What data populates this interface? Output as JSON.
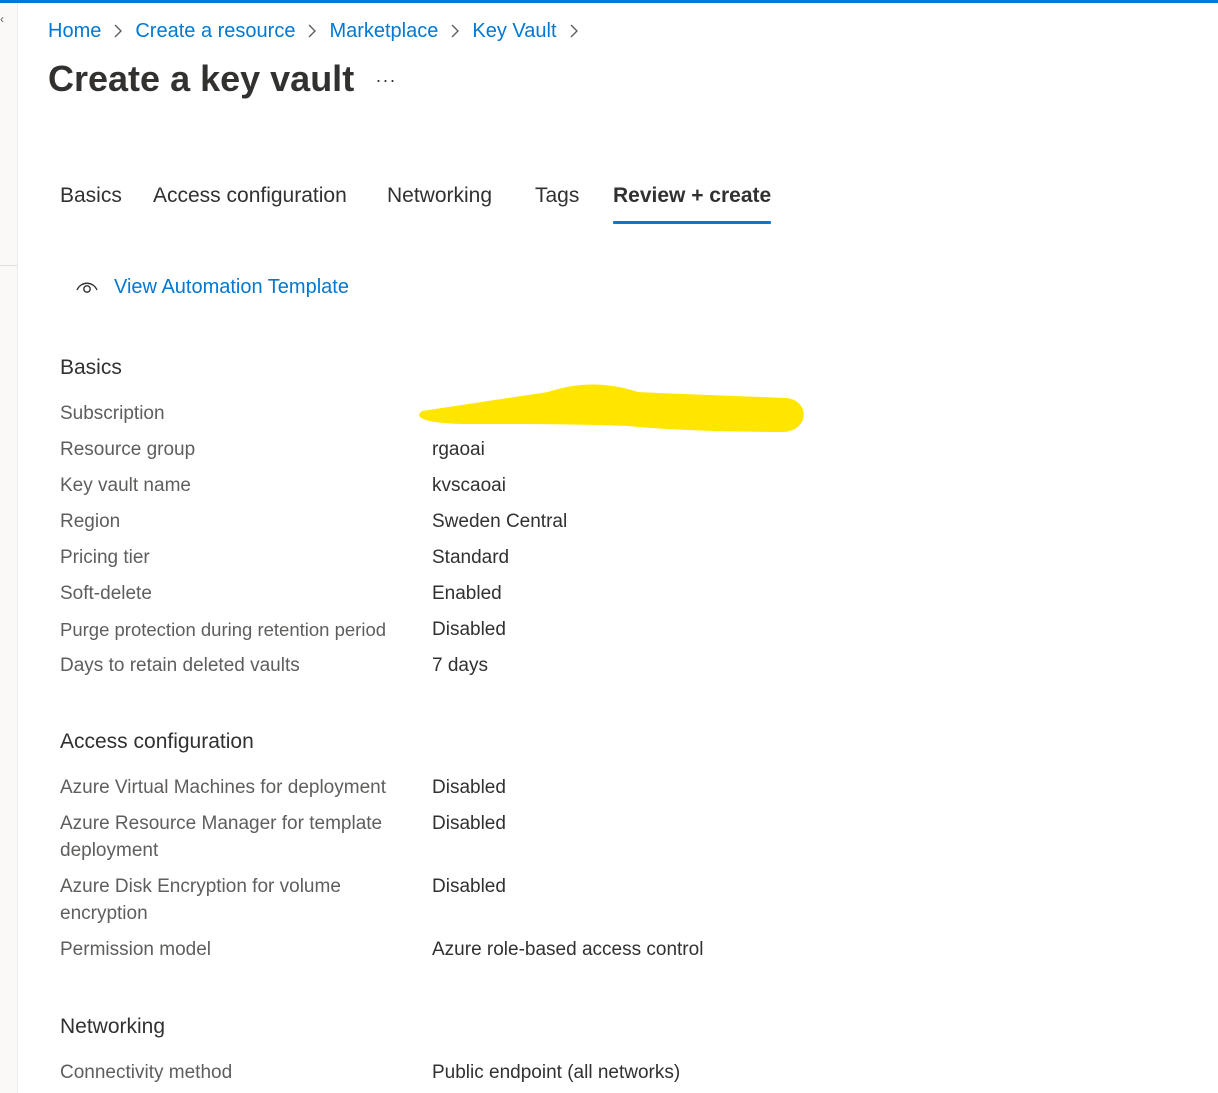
{
  "breadcrumb": {
    "items": [
      "Home",
      "Create a resource",
      "Marketplace",
      "Key Vault"
    ]
  },
  "page": {
    "title": "Create a key vault",
    "more_label": "···"
  },
  "tabs": [
    {
      "label": "Basics",
      "active": false
    },
    {
      "label": "Access configuration",
      "active": false
    },
    {
      "label": "Networking",
      "active": false
    },
    {
      "label": "Tags",
      "active": false
    },
    {
      "label": "Review + create",
      "active": true
    }
  ],
  "template_link": {
    "label": "View Automation Template",
    "icon": "eye-icon"
  },
  "sections": {
    "basics": {
      "heading": "Basics",
      "rows": [
        {
          "label": "Subscription",
          "value": ""
        },
        {
          "label": "Resource group",
          "value": "rgaoai"
        },
        {
          "label": "Key vault name",
          "value": "kvscaoai"
        },
        {
          "label": "Region",
          "value": "Sweden Central"
        },
        {
          "label": "Pricing tier",
          "value": "Standard"
        },
        {
          "label": "Soft-delete",
          "value": "Enabled"
        },
        {
          "label": "Purge protection during retention period",
          "value": "Disabled"
        },
        {
          "label": "Days to retain deleted vaults",
          "value": "7 days"
        }
      ]
    },
    "access": {
      "heading": "Access configuration",
      "rows": [
        {
          "label": "Azure Virtual Machines for deployment",
          "value": "Disabled"
        },
        {
          "label": "Azure Resource Manager for template deployment",
          "value": "Disabled"
        },
        {
          "label": "Azure Disk Encryption for volume encryption",
          "value": "Disabled"
        },
        {
          "label": "Permission model",
          "value": "Azure role-based access control"
        }
      ]
    },
    "networking": {
      "heading": "Networking",
      "rows": [
        {
          "label": "Connectivity method",
          "value": "Public endpoint (all networks)"
        }
      ]
    }
  },
  "colors": {
    "accent": "#0078d4",
    "redaction": "#ffe600"
  }
}
